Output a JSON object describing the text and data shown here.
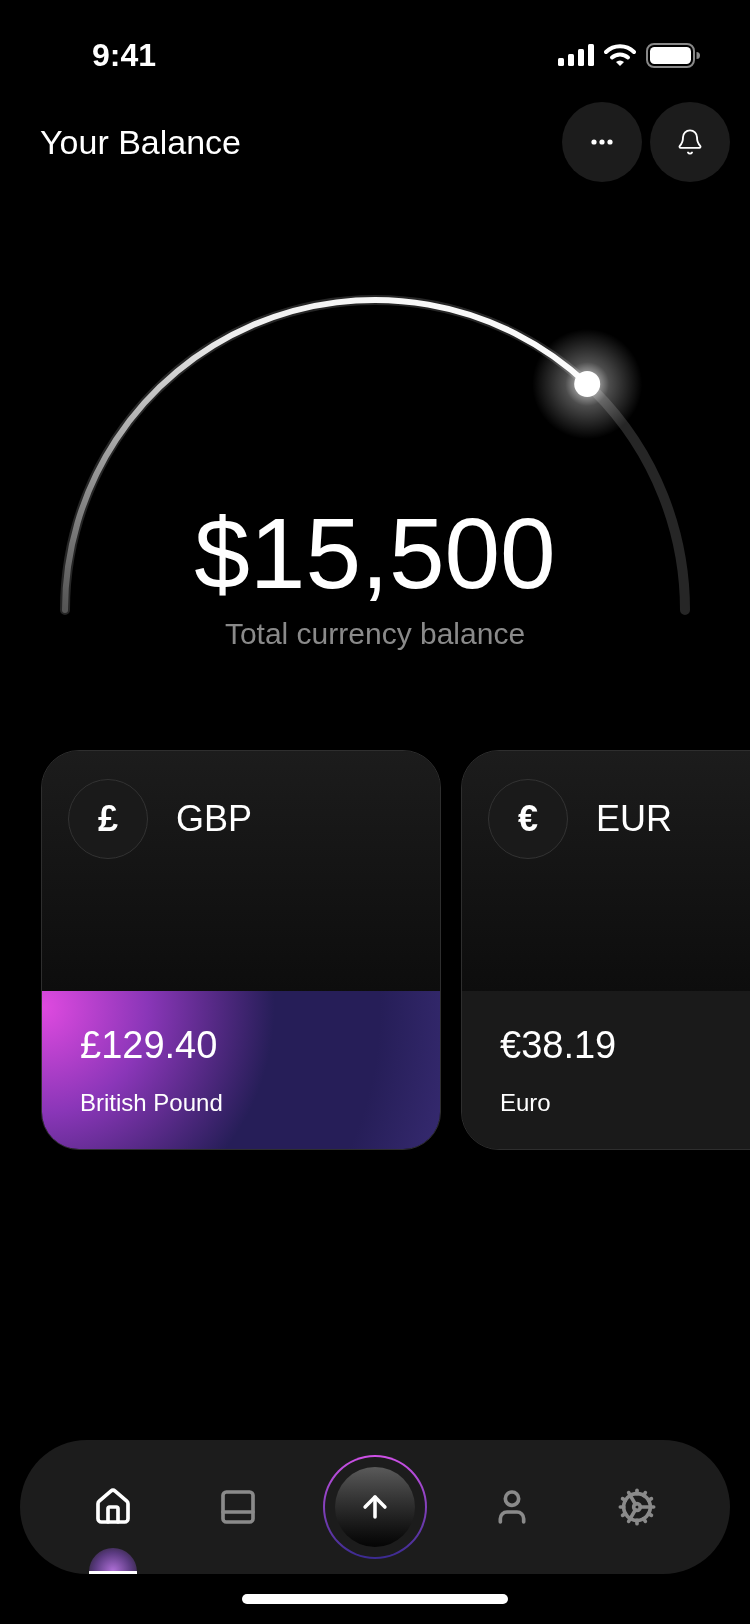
{
  "status_bar": {
    "time": "9:41"
  },
  "header": {
    "title": "Your Balance"
  },
  "gauge": {
    "level": 0.74,
    "amount": "$15,500",
    "caption": "Total currency balance"
  },
  "cards": [
    {
      "symbol": "£",
      "code": "GBP",
      "amount": "£129.40",
      "name": "British Pound",
      "selected": true
    },
    {
      "symbol": "€",
      "code": "EUR",
      "amount": "€38.19",
      "name": "Euro",
      "selected": false
    }
  ],
  "nav": [
    {
      "kind": "home",
      "selected": true
    },
    {
      "kind": "card",
      "selected": false
    },
    {
      "kind": "send",
      "selected": false
    },
    {
      "kind": "profile",
      "selected": false
    },
    {
      "kind": "settings",
      "selected": false
    }
  ]
}
